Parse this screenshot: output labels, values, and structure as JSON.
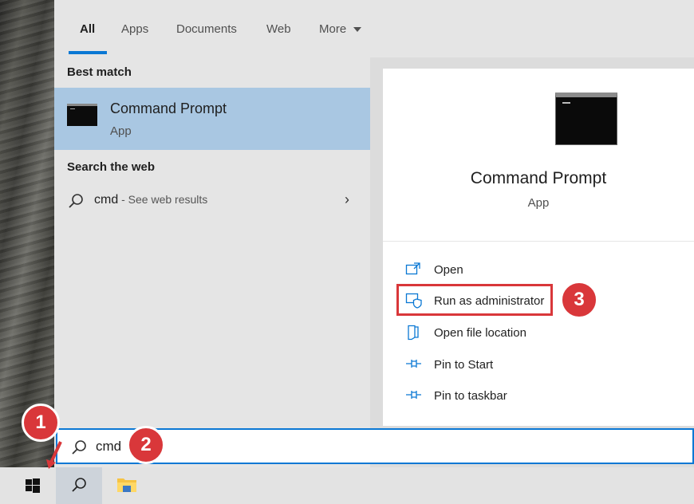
{
  "tabs": [
    {
      "label": "All",
      "active": true
    },
    {
      "label": "Apps"
    },
    {
      "label": "Documents"
    },
    {
      "label": "Web"
    },
    {
      "label": "More",
      "icon": "caret-down"
    }
  ],
  "left_panel": {
    "best_match_heading": "Best match",
    "best_match": {
      "title": "Command Prompt",
      "subtitle": "App",
      "icon": "command-prompt-icon"
    },
    "search_web_heading": "Search the web",
    "web_result": {
      "query": "cmd",
      "suffix": " - See web results",
      "icon": "search-icon"
    }
  },
  "right_panel": {
    "title": "Command Prompt",
    "subtitle": "App",
    "actions": [
      {
        "label": "Open",
        "icon": "open-icon"
      },
      {
        "label": "Run as administrator",
        "icon": "shield-icon"
      },
      {
        "label": "Open file location",
        "icon": "file-location-icon"
      },
      {
        "label": "Pin to Start",
        "icon": "pin-icon"
      },
      {
        "label": "Pin to taskbar",
        "icon": "pin-icon"
      }
    ]
  },
  "search_box": {
    "value": "cmd",
    "icon": "search-icon"
  },
  "taskbar": {
    "items": [
      "windows-start-icon",
      "search-icon",
      "file-explorer-icon"
    ]
  },
  "annotations": {
    "step1": "1",
    "step2": "2",
    "step3": "3"
  },
  "colors": {
    "accent": "#0a78d4",
    "selection": "#a9c7e2",
    "annotation_red": "#d9373a"
  }
}
